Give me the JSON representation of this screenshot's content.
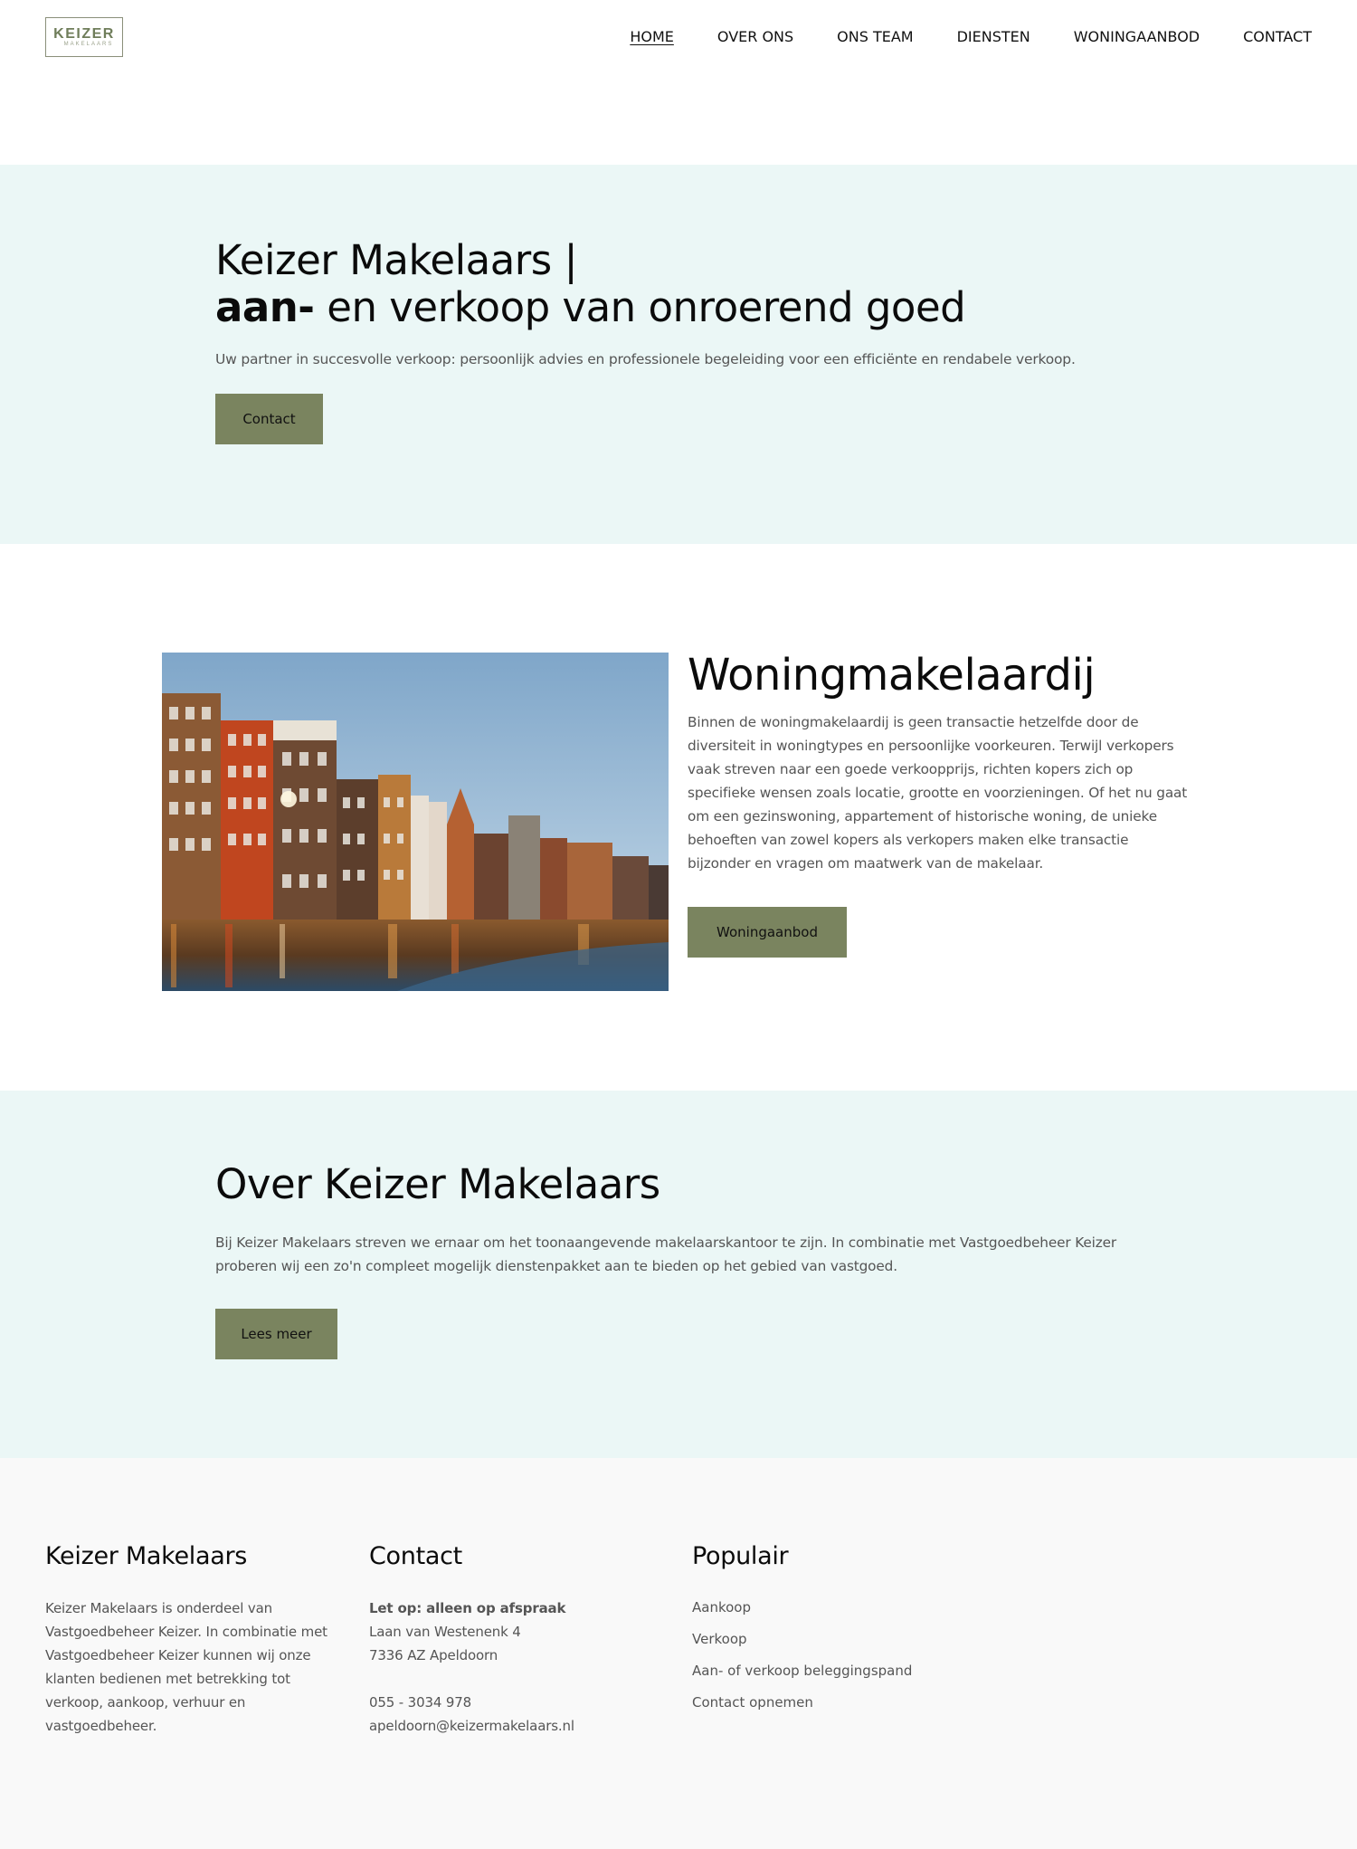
{
  "brand": {
    "logo_main": "KEIZER",
    "logo_sub": "MAKELAARS",
    "accent_color": "#7a845f",
    "band_color": "#ebf7f6",
    "footer_color": "#f9f9f9"
  },
  "nav": {
    "items": [
      {
        "label": "HOME",
        "active": true
      },
      {
        "label": "OVER ONS",
        "active": false
      },
      {
        "label": "ONS TEAM",
        "active": false
      },
      {
        "label": "DIENSTEN",
        "active": false
      },
      {
        "label": "WONINGAANBOD",
        "active": false
      },
      {
        "label": "CONTACT",
        "active": false
      }
    ]
  },
  "hero": {
    "title_line1": "Keizer Makelaars |",
    "title_line2_bold": "aan-",
    "title_line2_rest": " en verkoop van onroerend goed",
    "subtitle": "Uw partner in succesvolle verkoop: persoonlijk advies en professionele begeleiding voor een efficiënte en rendabele verkoop.",
    "button_label": "Contact"
  },
  "woning": {
    "image_alt": "Amsterdam canal houses",
    "title": "Woningmakelaardij",
    "text": "Binnen de woningmakelaardij is geen transactie hetzelfde door de diversiteit in woningtypes en persoonlijke voorkeuren. Terwijl verkopers vaak streven naar een goede verkoopprijs, richten kopers zich op specifieke wensen zoals locatie, grootte en voorzieningen. Of het nu gaat om een gezinswoning, appartement of historische woning, de unieke behoeften van zowel kopers als verkopers maken elke transactie bijzonder en vragen om maatwerk van de makelaar.",
    "button_label": "Woningaanbod"
  },
  "about": {
    "title": "Over Keizer Makelaars",
    "text": "Bij Keizer Makelaars streven we ernaar om het toonaangevende makelaarskantoor te zijn. In combinatie met Vastgoedbeheer Keizer proberen wij een zo'n compleet mogelijk dienstenpakket aan te bieden op het gebied van vastgoed.",
    "button_label": "Lees meer"
  },
  "footer": {
    "col1": {
      "title": "Keizer Makelaars",
      "text": "Keizer Makelaars is onderdeel van Vastgoedbeheer Keizer. In combinatie met Vastgoedbeheer Keizer kunnen wij onze klanten bedienen met betrekking tot verkoop, aankoop, verhuur en vastgoedbeheer."
    },
    "col2": {
      "title": "Contact",
      "notice": "Let op: alleen op afspraak",
      "street": "Laan van Westenenk 4",
      "city": "7336 AZ Apeldoorn",
      "phone": "055 - 3034 978",
      "email": "apeldoorn@keizermakelaars.nl"
    },
    "col3": {
      "title": "Populair",
      "links": [
        "Aankoop",
        "Verkoop",
        "Aan- of verkoop beleggingspand",
        "Contact opnemen"
      ]
    }
  }
}
